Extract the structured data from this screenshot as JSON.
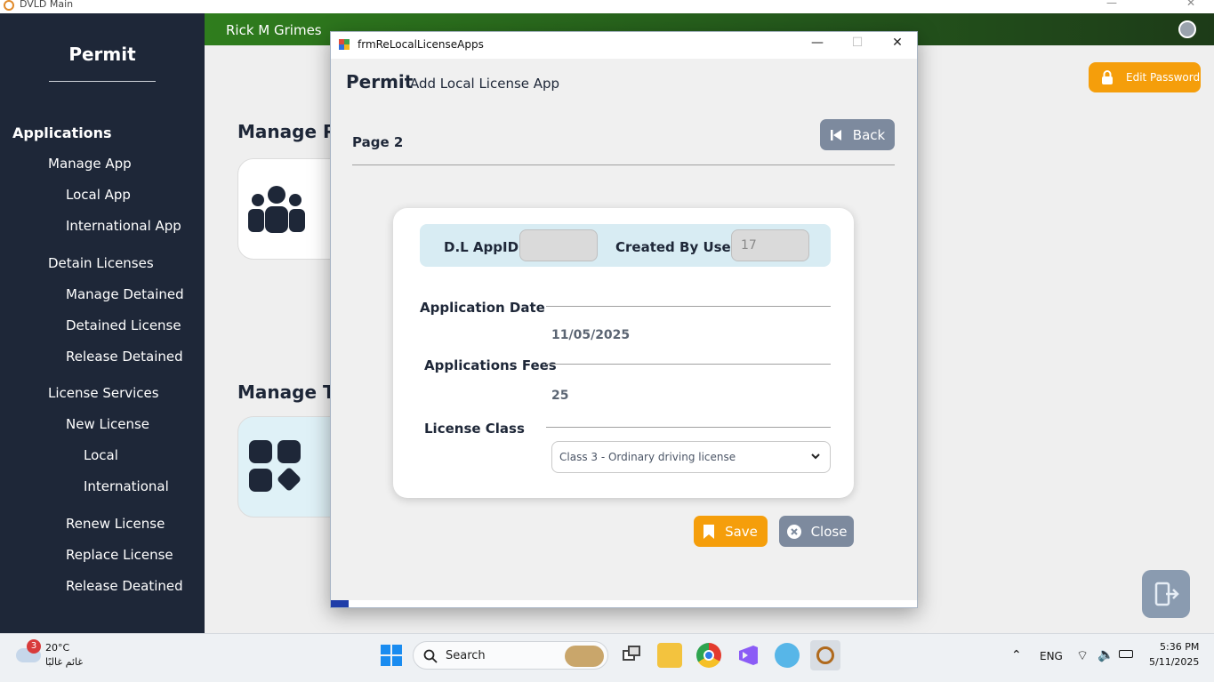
{
  "main_window": {
    "title": "DVLD Main"
  },
  "sidebar": {
    "title": "Permit",
    "items": [
      {
        "label": "Applications"
      },
      {
        "label": "Manage App"
      },
      {
        "label": "Local App"
      },
      {
        "label": "International App"
      },
      {
        "label": "Detain Licenses"
      },
      {
        "label": "Manage Detained"
      },
      {
        "label": "Detained License"
      },
      {
        "label": "Release Detained"
      },
      {
        "label": "License Services"
      },
      {
        "label": "New License"
      },
      {
        "label": "Local"
      },
      {
        "label": "International"
      },
      {
        "label": "Renew License"
      },
      {
        "label": "Replace License"
      },
      {
        "label": "Release Deatined"
      }
    ]
  },
  "header": {
    "user_name": "Rick M  Grimes",
    "edit_password_label": "Edit Password"
  },
  "main": {
    "section1_title": "Manage Pe",
    "section2_title": "Manage Ty"
  },
  "dialog": {
    "title": "frmReLocalLicenseApps",
    "heading_bold": "Permit",
    "heading_sub": "Add Local License App",
    "page_label": "Page 2",
    "back_label": "Back",
    "dl_appid_label": "D.L AppID",
    "dl_appid_value": "",
    "created_by_label": "Created By User",
    "created_by_value": "17",
    "app_date_label": "Application Date",
    "app_date_value": "11/05/2025",
    "app_fees_label": "Applications Fees",
    "app_fees_value": "25",
    "license_class_label": "License Class",
    "license_class_selected": "Class 3 - Ordinary driving license",
    "save_label": "Save",
    "close_label": "Close"
  },
  "taskbar": {
    "weather_badge": "3",
    "weather_temp": "20°C",
    "weather_desc": "غائم غالبًا",
    "search_label": "Search",
    "language": "ENG",
    "time": "5:36 PM",
    "date": "5/11/2025"
  },
  "colors": {
    "accent_orange": "#f59e0b",
    "sidebar_bg": "#1e2738",
    "button_gray": "#7d8a9e",
    "header_green": "#2f7d1d"
  }
}
